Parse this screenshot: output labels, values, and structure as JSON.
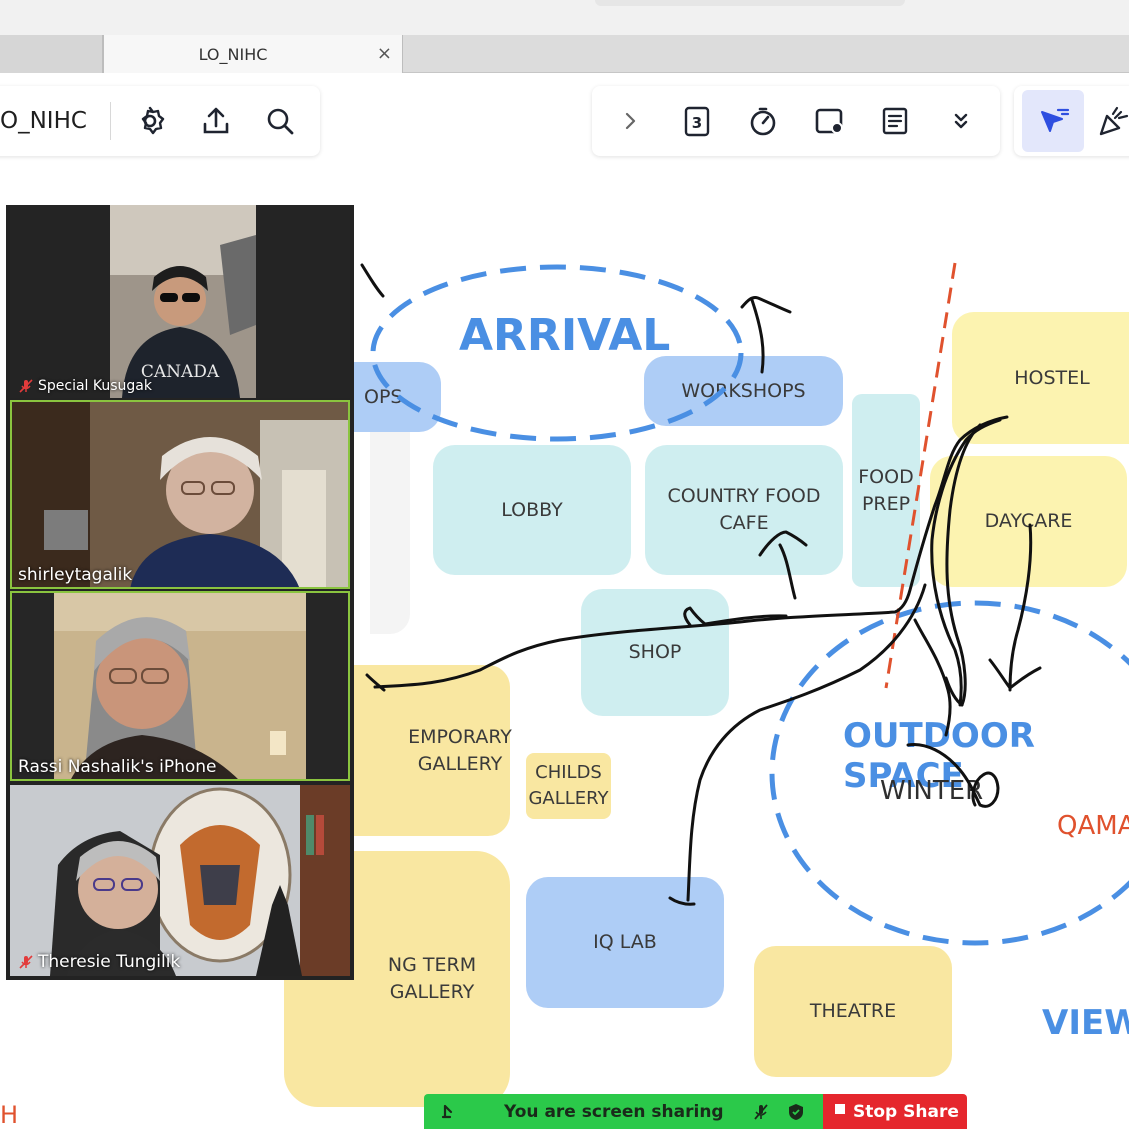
{
  "browser": {
    "tab_title": "LO_NIHC",
    "tab_close": "×"
  },
  "board": {
    "name": "O_NIHC",
    "left_tools": [
      "gear-icon",
      "upload-icon",
      "search-icon"
    ],
    "mid_tools": [
      "chevron-right-icon",
      "frame-counter-icon",
      "timer-icon",
      "video-dot-icon",
      "notes-icon",
      "double-chevron-down-icon"
    ],
    "frame_count": "3"
  },
  "canvas": {
    "labels": {
      "arrival": "ARRIVAL",
      "outdoor_space": "OUTDOOR SPACE",
      "winter": "WINTER",
      "qama": "QAMA",
      "view": "VIEW",
      "edge_h": "H"
    },
    "stickies": {
      "ops": "OPS",
      "workshops": "WORKSHOPS",
      "hostel": "HOSTEL",
      "lobby": "LOBBY",
      "country_food_1": "COUNTRY FOOD",
      "country_food_2": "CAFE",
      "food_prep_1": "FOOD",
      "food_prep_2": "PREP",
      "daycare": "DAYCARE",
      "shop": "SHOP",
      "temporary_1": "EMPORARY",
      "temporary_2": "GALLERY",
      "childs_1": "CHILDS",
      "childs_2": "GALLERY",
      "long_term_1": "NG TERM",
      "long_term_2": "GALLERY",
      "iq_lab": "IQ LAB",
      "theatre": "THEATRE"
    },
    "colors": {
      "accent_blue": "#4a8fe3",
      "divider_red": "#e0522e",
      "qama_orange": "#e0522e"
    }
  },
  "meeting": {
    "participants": [
      {
        "name": "Special Kusugak",
        "muted": true
      },
      {
        "name": "shirleytagalik",
        "muted": false
      },
      {
        "name": "Rassi Nashalik's iPhone",
        "muted": false
      },
      {
        "name": "Theresie Tungilik",
        "muted": true
      }
    ],
    "share_bar": {
      "status": "You are screen sharing",
      "stop_label": "Stop Share"
    }
  }
}
